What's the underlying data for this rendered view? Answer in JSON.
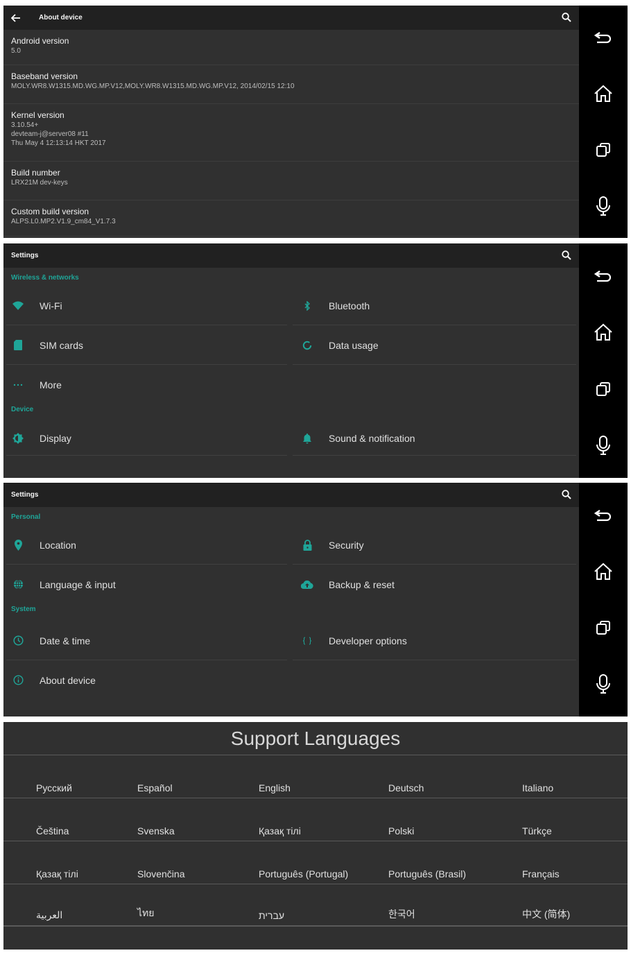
{
  "colors": {
    "accent": "#1fa598",
    "appbar": "#212121",
    "background": "#303030",
    "navbar": "#000000"
  },
  "navbar": {
    "icons": [
      "back-icon",
      "home-icon",
      "recents-icon",
      "mic-icon"
    ]
  },
  "about": {
    "title": "About device",
    "items": [
      {
        "label": "Android version",
        "values": [
          "5.0"
        ]
      },
      {
        "label": "Baseband version",
        "values": [
          "MOLY.WR8.W1315.MD.WG.MP.V12,MOLY.WR8.W1315.MD.WG.MP.V12, 2014/02/15 12:10"
        ]
      },
      {
        "label": "Kernel version",
        "values": [
          "3.10.54+",
          "devteam-j@server08 #11",
          "Thu May 4 12:13:14 HKT 2017"
        ]
      },
      {
        "label": "Build number",
        "values": [
          "LRX21M dev-keys"
        ]
      },
      {
        "label": "Custom build version",
        "values": [
          "ALPS.L0.MP2.V1.9_cm84_V1.7.3"
        ]
      }
    ]
  },
  "settings1": {
    "title": "Settings",
    "categories": [
      {
        "name": "Wireless & networks",
        "items": [
          {
            "label": "Wi-Fi",
            "icon": "wifi-icon"
          },
          {
            "label": "Bluetooth",
            "icon": "bluetooth-icon"
          },
          {
            "label": "SIM cards",
            "icon": "sim-card-icon"
          },
          {
            "label": "Data usage",
            "icon": "data-usage-icon"
          },
          {
            "label": "More",
            "icon": "more-icon"
          }
        ]
      },
      {
        "name": "Device",
        "items": [
          {
            "label": "Display",
            "icon": "display-icon"
          },
          {
            "label": "Sound & notification",
            "icon": "bell-icon"
          }
        ]
      }
    ]
  },
  "settings2": {
    "title": "Settings",
    "categories": [
      {
        "name": "Personal",
        "items": [
          {
            "label": "Location",
            "icon": "location-icon"
          },
          {
            "label": "Security",
            "icon": "lock-icon"
          },
          {
            "label": "Language & input",
            "icon": "globe-icon"
          },
          {
            "label": "Backup & reset",
            "icon": "cloud-upload-icon"
          }
        ]
      },
      {
        "name": "System",
        "items": [
          {
            "label": "Date & time",
            "icon": "clock-icon"
          },
          {
            "label": "Developer options",
            "icon": "braces-icon"
          },
          {
            "label": "About device",
            "icon": "info-icon"
          }
        ]
      }
    ]
  },
  "languages": {
    "title": "Support Languages",
    "rows": [
      [
        "Русский",
        "Español",
        "English",
        "Deutsch",
        "Italiano"
      ],
      [
        "Čeština",
        "Svenska",
        "Қазақ тілі",
        "Polski",
        "Türkçe"
      ],
      [
        "Қазақ тілі",
        "Slovenčina",
        "Português (Portugal)",
        "Português (Brasil)",
        "Français"
      ],
      [
        "العربية",
        "ไทย",
        "עברית",
        "한국어",
        "中文 (简体)"
      ]
    ]
  }
}
